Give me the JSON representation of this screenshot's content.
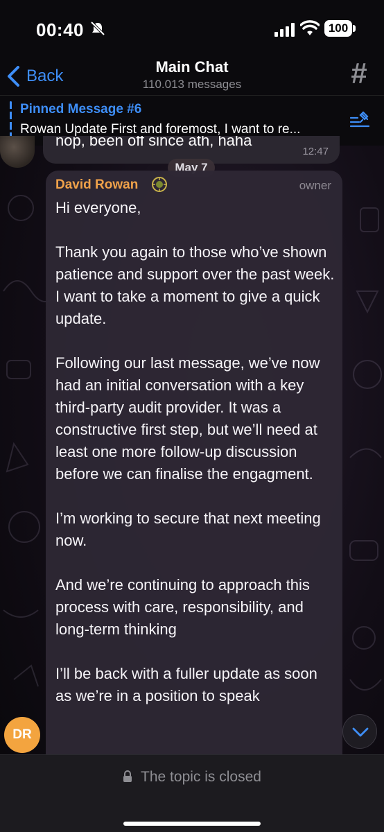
{
  "status_bar": {
    "time": "00:40",
    "battery": "100",
    "icons": [
      "bell-muted-icon",
      "signal-icon",
      "wifi-icon",
      "battery-icon"
    ]
  },
  "header": {
    "back_label": "Back",
    "title": "Main Chat",
    "subtitle": "110.013 messages",
    "right_icon": "hashtag-icon"
  },
  "pinned": {
    "title": "Pinned Message #6",
    "text": "Rowan Update First and foremost, I want to re..."
  },
  "messages": {
    "previous": {
      "text": "nop, been off since ath, haha",
      "time": "12:47"
    },
    "date_separator": "May 7",
    "current": {
      "sender": "David Rowan",
      "role": "owner",
      "avatar_initials": "DR",
      "paragraphs": [
        "Hi everyone,",
        "Thank you again to those who’ve shown patience and support over the past week. I want to take a moment to give a quick update.",
        "Following our last message, we’ve now had an initial conversation with a key third-party audit provider. It was a constructive first step, but we’ll need at least one more follow-up discussion before we can finalise the engagment.",
        "I’m working to secure that next meeting now.",
        "And we’re continuing to approach this process with care, responsibility, and long-term thinking",
        "I’ll be back with a fuller update as soon as we’re in a position to speak"
      ]
    }
  },
  "footer": {
    "closed_text": "The topic is closed"
  },
  "colors": {
    "accent": "#3e8ef7",
    "sender": "#f0a24a",
    "avatar": "#f3a43f"
  }
}
